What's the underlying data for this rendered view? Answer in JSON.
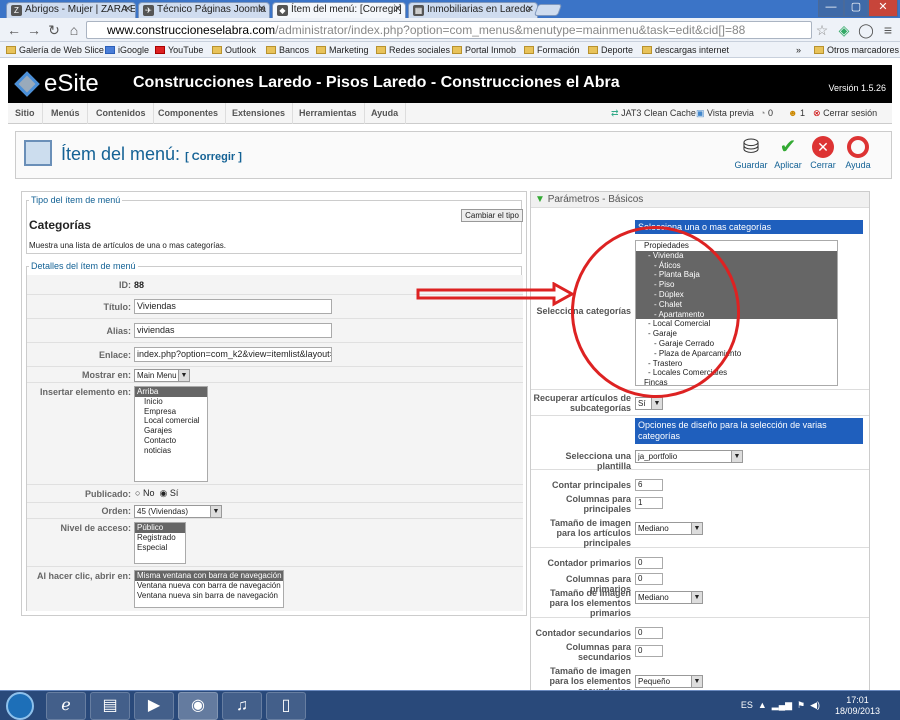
{
  "browser": {
    "tabs": [
      {
        "label": "Abrigos - Mujer | ZARA Es",
        "icon": "Z"
      },
      {
        "label": "Técnico Páginas Joomla |",
        "icon": "✈"
      },
      {
        "label": "Ítem del menú: [Corregir]",
        "icon": "◆"
      },
      {
        "label": "Inmobiliarias en Laredo",
        "icon": "▦"
      }
    ],
    "url_host": "www.construccioneselabra.com",
    "url_path": "/administrator/index.php?option=com_menus&menutype=mainmenu&task=edit&cid[]=88",
    "bookmarks": [
      "Galería de Web Slice",
      "iGoogle",
      "YouTube",
      "Outlook",
      "Bancos",
      "Marketing",
      "Redes sociales",
      "Portal Inmob",
      "Formación",
      "Deporte",
      "descargas internet"
    ],
    "other_bookmarks": "Otros marcadores"
  },
  "admin": {
    "logo": "eSite",
    "site_title": "Construcciones Laredo - Pisos Laredo - Construcciones el Abra",
    "version": "Versión 1.5.26",
    "menu": [
      "Sitio",
      "Menús",
      "Contenidos",
      "Componentes",
      "Extensiones",
      "Herramientas",
      "Ayuda"
    ],
    "right_links": {
      "cache": "JAT3 Clean Cache",
      "preview": "Vista previa",
      "msgs": "0",
      "users": "1",
      "logout": "Cerrar sesión"
    }
  },
  "page": {
    "title": "Ítem del menú:",
    "subtitle": "[ Corregir ]",
    "buttons": [
      "Guardar",
      "Aplicar",
      "Cerrar",
      "Ayuda"
    ]
  },
  "tipo": {
    "legend": "Tipo del ítem de menú",
    "heading": "Categorías",
    "change_btn": "Cambiar el tipo",
    "desc": "Muestra una lista de artículos de una o mas categorías."
  },
  "detalles": {
    "legend": "Detalles del ítem de menú",
    "id_label": "ID:",
    "id_value": "88",
    "titulo_label": "Título:",
    "titulo_value": "Viviendas",
    "alias_label": "Alias:",
    "alias_value": "viviendas",
    "enlace_label": "Enlace:",
    "enlace_value": "index.php?option=com_k2&view=itemlist&layout=c",
    "mostrar_label": "Mostrar en:",
    "mostrar_value": "Main Menu",
    "insertar_label": "Insertar elemento en:",
    "insertar_items": [
      "Arriba",
      "Inicio",
      "Empresa",
      "Local comercial",
      "Garajes",
      "Contacto",
      "noticias"
    ],
    "publicado_label": "Publicado:",
    "no": "No",
    "si": "Sí",
    "orden_label": "Orden:",
    "orden_value": "45 (Viviendas)",
    "acceso_label": "Nivel de acceso:",
    "acceso_items": [
      "Público",
      "Registrado",
      "Especial"
    ],
    "clic_label": "Al hacer clic, abrir en:",
    "clic_items": [
      "Misma ventana con barra de navegación",
      "Ventana nueva con barra de navegación",
      "Ventana nueva sin barra de navegación"
    ]
  },
  "params": {
    "header": "Parámetros - Básicos",
    "cat_bar": "Selecciona una o mas categorías",
    "cat_label": "Selecciona categorías",
    "categories": [
      {
        "t": "Propiedades",
        "s": false
      },
      {
        "t": "- Vivienda",
        "s": true
      },
      {
        "t": "- Áticos",
        "s": true
      },
      {
        "t": "- Planta Baja",
        "s": true
      },
      {
        "t": "- Piso",
        "s": true
      },
      {
        "t": "- Dúplex",
        "s": true
      },
      {
        "t": "- Chalet",
        "s": true
      },
      {
        "t": "- Apartamento",
        "s": true
      },
      {
        "t": "- Local Comercial",
        "s": false
      },
      {
        "t": "- Garaje",
        "s": false
      },
      {
        "t": "- Garaje Cerrado",
        "s": false
      },
      {
        "t": "- Plaza de Aparcamiento",
        "s": false
      },
      {
        "t": "- Trastero",
        "s": false
      },
      {
        "t": "- Locales Comerciales",
        "s": false
      },
      {
        "t": "Fincas",
        "s": false
      }
    ],
    "recuperar_label": "Recuperar artículos de subcategorías",
    "recuperar_value": "Sí",
    "diseno_bar": "Opciones de diseño para la selección de varias categorías",
    "plantilla_label": "Selecciona una plantilla",
    "plantilla_value": "ja_portfolio",
    "contar_label": "Contar principales",
    "contar_value": "6",
    "columnas_label": "Columnas para principales",
    "columnas_value": "1",
    "tam_label": "Tamaño de imagen para los artículos principales",
    "tam_value": "Mediano",
    "contprim_label": "Contador primarios",
    "contprim_value": "0",
    "colprim_label": "Columnas para primarios",
    "colprim_value": "0",
    "tamprim_label": "Tamaño de imagen para los elementos primarios",
    "tamprim_value": "Mediano",
    "contsec_label": "Contador secundarios",
    "contsec_value": "0",
    "colsec_label": "Columnas para secundarios",
    "colsec_value": "0",
    "tamsec_label": "Tamaño de imagen para los elementos secundarios",
    "tamsec_value": "Pequeño"
  },
  "taskbar": {
    "lang": "ES",
    "time": "17:01",
    "date": "18/09/2013"
  }
}
